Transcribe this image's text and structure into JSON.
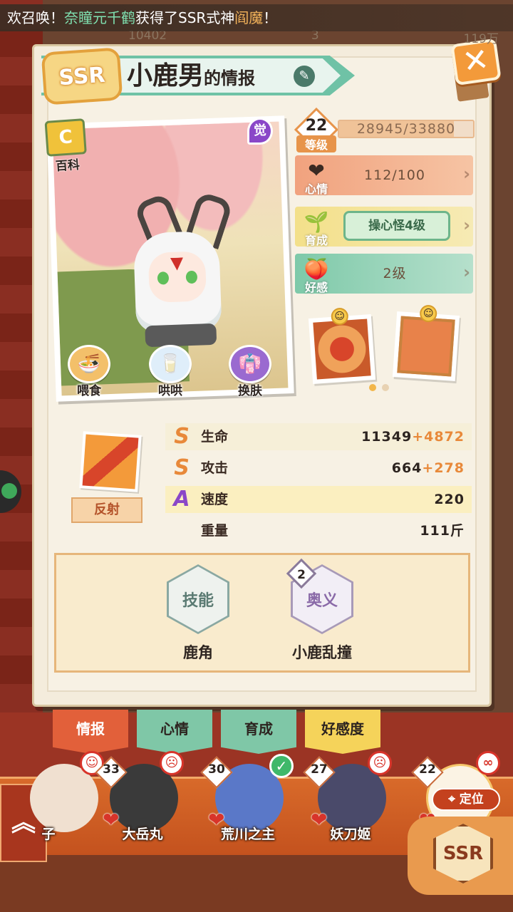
{
  "announcement": {
    "prefix": "欢召唤！",
    "player": "奈瞳元千鹤",
    "middle": "获得了SSR式神",
    "shikigami": "阎魔",
    "suffix": "！"
  },
  "counters": [
    "10402",
    "3",
    "119万"
  ],
  "header": {
    "rarity": "SSR",
    "name": "小鹿男",
    "suffix": "的情报",
    "edit_icon": "pencil-icon",
    "close_label": "✕"
  },
  "portrait": {
    "baike_label": "百科",
    "awaken_label": "觉",
    "buttons": [
      {
        "label": "喂食",
        "icon": "bowl-icon"
      },
      {
        "label": "哄哄",
        "icon": "milk-icon"
      },
      {
        "label": "换肤",
        "icon": "robe-icon"
      }
    ]
  },
  "level": {
    "value": "22",
    "label": "等级",
    "exp_text": "28945/33880",
    "exp_fraction": 0.854
  },
  "mood": {
    "label": "心情",
    "value": "112/100"
  },
  "growth": {
    "label": "育成",
    "value": "操心怪4级"
  },
  "favor": {
    "label": "好感",
    "value": "2级"
  },
  "gifts": [
    "hotpot-gift",
    "mystery-gift"
  ],
  "passive_skill": {
    "label": "反射"
  },
  "stats": [
    {
      "grade": "S",
      "name": "生命",
      "base": "11349",
      "bonus": "+4872"
    },
    {
      "grade": "S",
      "name": "攻击",
      "base": "664",
      "bonus": "+278"
    },
    {
      "grade": "A",
      "name": "速度",
      "base": "220",
      "bonus": ""
    },
    {
      "grade": "",
      "name": "重量",
      "base": "111斤",
      "bonus": ""
    }
  ],
  "skills": [
    {
      "hex": "技能",
      "name": "鹿角",
      "badge": ""
    },
    {
      "hex": "奥义",
      "name": "小鹿乱撞",
      "badge": "2"
    }
  ],
  "tabs": [
    {
      "label": "情报",
      "active": true
    },
    {
      "label": "心情",
      "active": false
    },
    {
      "label": "育成",
      "active": false
    },
    {
      "label": "好感度",
      "active": false
    }
  ],
  "roster": [
    {
      "name": "子",
      "level": ""
    },
    {
      "name": "大岳丸",
      "level": "33"
    },
    {
      "name": "荒川之主",
      "level": "30"
    },
    {
      "name": "妖刀姬",
      "level": "27"
    },
    {
      "name": "",
      "level": "22"
    }
  ],
  "locate_label": "定位",
  "ssr_button": "SSR",
  "up_icon": "chevron-up-double-icon",
  "colors": {
    "accent_orange": "#e8893a",
    "mint": "#6fc2a6",
    "card_bg": "#f4ecdc",
    "grade_s": "#e8893a",
    "grade_a": "#8a47c8"
  }
}
